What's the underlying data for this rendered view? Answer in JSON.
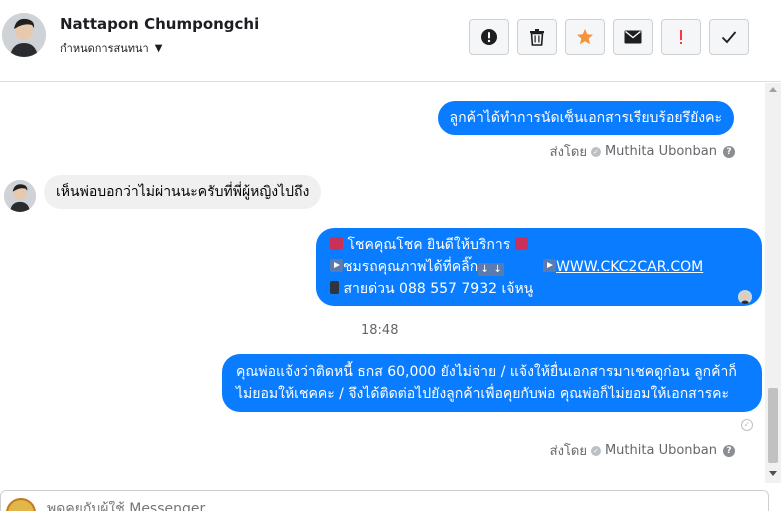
{
  "header": {
    "name": "Nattapon Chumpongchi",
    "subtitle": "กำหนดการสนทนา",
    "toolbar": [
      {
        "icon": "alert-circle-icon",
        "label": "Report"
      },
      {
        "icon": "trash-icon",
        "label": "Delete"
      },
      {
        "icon": "star-icon",
        "label": "Star"
      },
      {
        "icon": "envelope-icon",
        "label": "Mark unread"
      },
      {
        "icon": "exclamation-icon",
        "label": "Flag"
      },
      {
        "icon": "check-icon",
        "label": "Done"
      }
    ]
  },
  "colors": {
    "outgoing_bubble": "#0a7cff",
    "incoming_bubble": "#f0f0f0",
    "star": "#f7923a",
    "flag": "#fa383e"
  },
  "thread": {
    "msg1": "ลูกค้าได้ทำการนัดเซ็นเอกสารเรียบร้อยรึยังคะ",
    "sent_by_1": {
      "prefix": "ส่งโดย",
      "agent": "Muthita Ubonban"
    },
    "msg2": "เห็นพ่อบอกว่าไม่ผ่านนะครับที่พี่ผู้หญิงไปถึง",
    "msg3": {
      "line1": "โชคคุณโชค ยินดีให้บริการ",
      "line2": "ชมรถคุณภาพได้ที่คลิ๊ก",
      "link": "WWW.CKC2CAR.COM",
      "line3": "สายด่วน 088 557 7932 เจ้หนู"
    },
    "time": "18:48",
    "msg4": "คุณพ่อแจ้งว่าติดหนี้ ธกส 60,000 ยังไม่จ่าย / แจ้งให้ยื่นเอกสารมาเชคดูก่อน ลูกค้าก็ไม่ยอมให้เชคคะ / จึงได้ติดต่อไปยังลูกค้าเพื่อคุยกับพ่อ คุณพ่อก็ไม่ยอมให้เอกสารคะ",
    "sent_by_2": {
      "prefix": "ส่งโดย",
      "agent": "Muthita Ubonban"
    }
  },
  "composer": {
    "placeholder": "พูดคุยกับผู้ใช้ Messenger"
  }
}
